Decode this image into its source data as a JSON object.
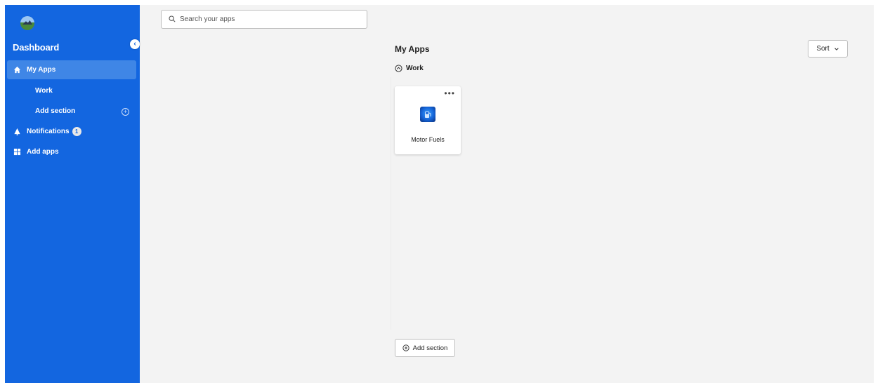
{
  "sidebar": {
    "title": "Dashboard",
    "collapse_glyph": "‹",
    "items": [
      {
        "label": "My Apps",
        "icon": "home-icon"
      },
      {
        "label": "Work"
      },
      {
        "label": "Add section",
        "icon": "plus-circle-icon"
      },
      {
        "label": "Notifications",
        "icon": "bell-icon",
        "badge": "1"
      },
      {
        "label": "Add apps",
        "icon": "grid-icon"
      }
    ]
  },
  "search": {
    "placeholder": "Search your apps"
  },
  "main": {
    "title": "My Apps",
    "sort_label": "Sort",
    "section": {
      "label": "Work"
    },
    "apps": [
      {
        "name": "Motor Fuels",
        "menu": "•••"
      }
    ],
    "add_section_label": "Add section"
  },
  "colors": {
    "sidebar": "#1366e0",
    "active_item": "#3f86e6",
    "background": "#f3f3f3"
  }
}
